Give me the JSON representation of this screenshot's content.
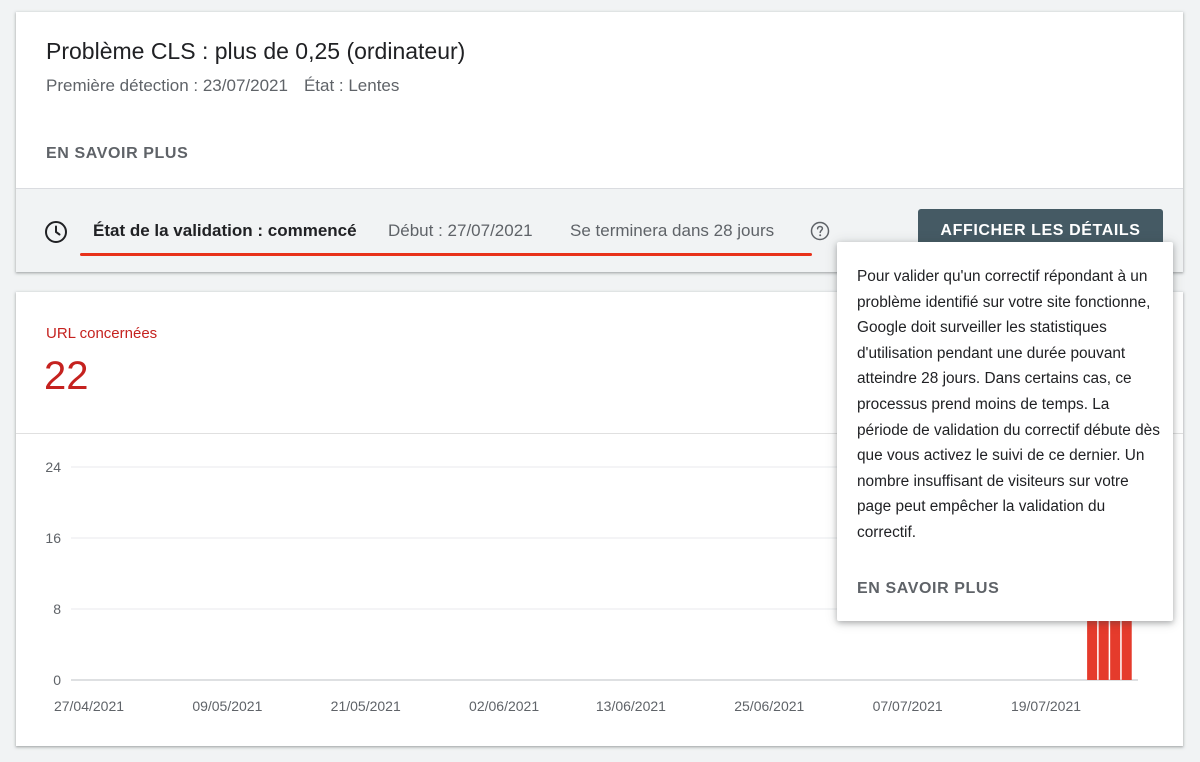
{
  "issue": {
    "title": "Problème CLS : plus de 0,25 (ordinateur)",
    "first_detected": "Première détection : 23/07/2021",
    "state": "État : Lentes",
    "learn_more": "EN SAVOIR PLUS"
  },
  "validation": {
    "status": "État de la validation : commencé",
    "start": "Début : 27/07/2021",
    "end": "Se terminera dans 28 jours",
    "details_button": "AFFICHER LES DÉTAILS"
  },
  "metric": {
    "label": "URL concernées",
    "value": "22"
  },
  "tooltip": {
    "text": "Pour valider qu'un correctif répondant à un problème identifié sur votre site fonctionne, Google doit surveiller les statistiques d'utilisation pendant une durée pouvant atteindre 28 jours. Dans certains cas, ce processus prend moins de temps. La période de validation du correctif débute dès que vous activez le suivi de ce dernier. Un nombre insuffisant de visiteurs sur votre page peut empêcher la validation du correctif.",
    "learn_more": "EN SAVOIR PLUS"
  },
  "colors": {
    "accent_red": "#c5221f",
    "bar_red": "#e53b2c",
    "underline_red": "#e8311a",
    "button_bg": "#455a64"
  },
  "icons": {
    "clock": "clock-icon",
    "help": "help-circle-icon"
  },
  "chart_data": {
    "type": "bar",
    "yticks": [
      "0",
      "8",
      "16",
      "24"
    ],
    "ylim": [
      0,
      24
    ],
    "xticks": [
      "27/04/2021",
      "09/05/2021",
      "21/05/2021",
      "02/06/2021",
      "13/06/2021",
      "25/06/2021",
      "07/07/2021",
      "19/07/2021"
    ],
    "x_start": "27/04/2021",
    "series": [
      {
        "values": [
          {
            "x": "23/07/2021",
            "y": 22
          },
          {
            "x": "24/07/2021",
            "y": 22
          },
          {
            "x": "25/07/2021",
            "y": 22
          },
          {
            "x": "26/07/2021",
            "y": 22
          }
        ]
      }
    ],
    "grid": true
  }
}
